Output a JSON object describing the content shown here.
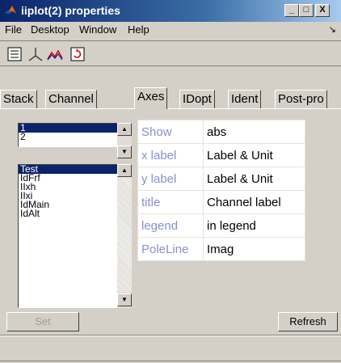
{
  "window": {
    "title": "iiplot(2) properties",
    "minimize": "_",
    "maximize": "□",
    "close": "X"
  },
  "menu": {
    "items": [
      "File",
      "Desktop",
      "Window",
      "Help"
    ],
    "dock_glyph": "↘"
  },
  "toolbar": {
    "icons": [
      "list-properties-icon",
      "axes-icon",
      "line-plot-icon",
      "refresh-plot-icon"
    ]
  },
  "tabs": [
    "Stack",
    "Channel",
    "Axes",
    "IDopt",
    "Ident",
    "Post-pro"
  ],
  "active_tab": "Axes",
  "list_top": {
    "items": [
      "1",
      "2"
    ],
    "selected": "1"
  },
  "list_bottom": {
    "items": [
      "Test",
      "IdFrf",
      "IIxh",
      "IIxi",
      "IdMain",
      "IdAlt"
    ],
    "selected": "Test"
  },
  "properties": [
    {
      "key": "Show",
      "value": "abs"
    },
    {
      "key": "x label",
      "value": "Label & Unit"
    },
    {
      "key": "y label",
      "value": "Label & Unit"
    },
    {
      "key": "title",
      "value": "Channel label"
    },
    {
      "key": "legend",
      "value": "in legend"
    },
    {
      "key": "PoleLine",
      "value": "Imag"
    }
  ],
  "buttons": {
    "set": "Set",
    "refresh": "Refresh"
  },
  "colors": {
    "title_bar": "#0a246a",
    "selection": "#0a246a",
    "property_key": "#8a8fcf"
  }
}
